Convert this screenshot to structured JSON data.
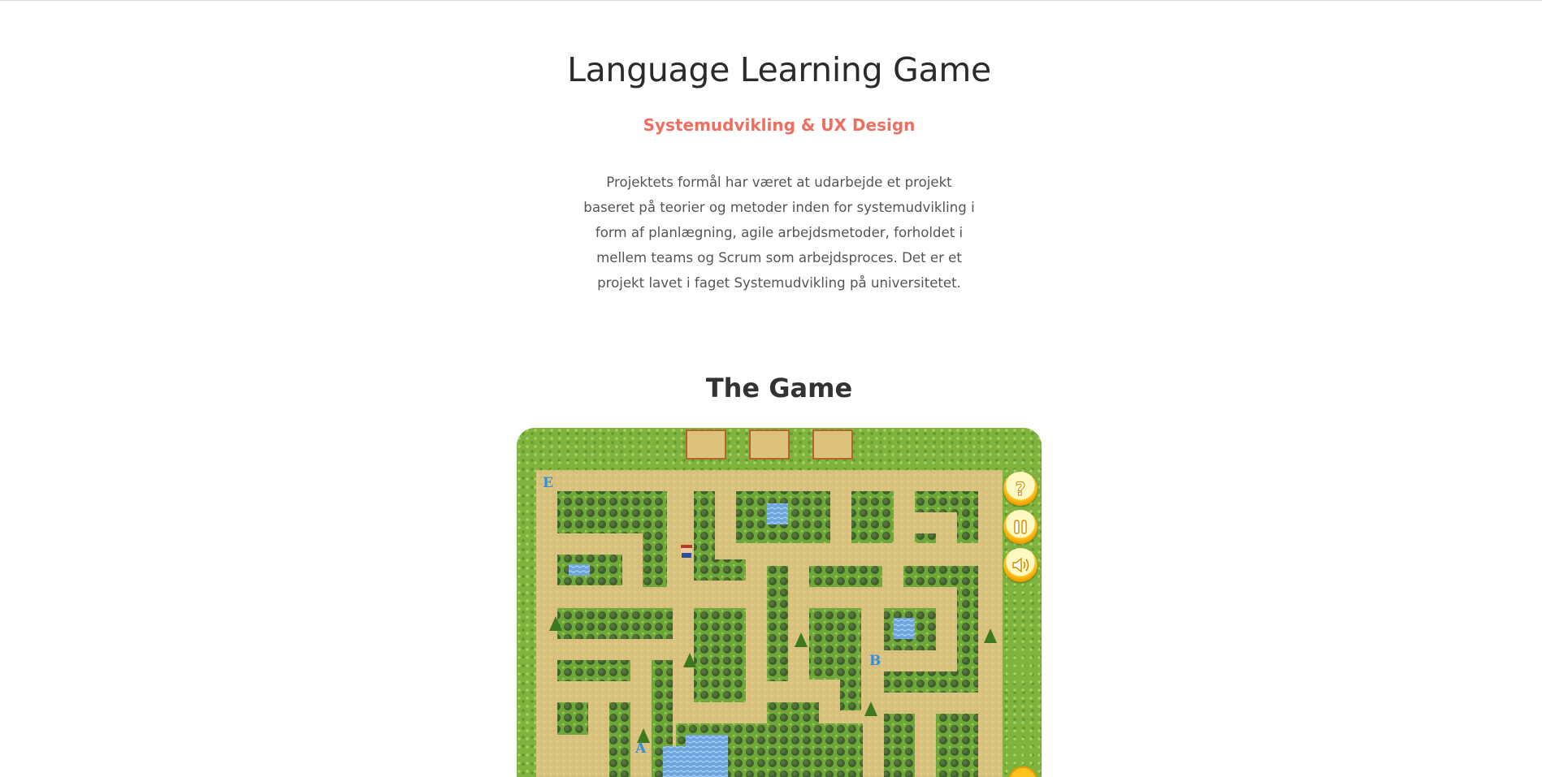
{
  "header": {
    "title": "Language Learning Game",
    "subtitle": "Systemudvikling & UX Design",
    "description": "Projektets formål har været at udarbejde et projekt baseret på teorier og metoder inden for systemudvikling i form af planlægning, agile arbejdsmetoder, forholdet i mellem teams og Scrum som arbejdsproces. Det er et projekt lavet i faget Systemudvikling på universitetet."
  },
  "game_section": {
    "title": "The Game",
    "letters": [
      "E",
      "B",
      "A"
    ],
    "controls": [
      {
        "name": "help-button",
        "icon": "question-mark-icon"
      },
      {
        "name": "pause-button",
        "icon": "pause-icon"
      },
      {
        "name": "sound-button",
        "icon": "speaker-icon"
      }
    ],
    "colors": {
      "grass": "#7fb23f",
      "path": "#d8c27e",
      "hedge": "#4f8a2a",
      "water": "#6fa6e0",
      "letter": "#2f8fe0",
      "button": "#ffc21f",
      "slot_border": "#b4622e"
    }
  }
}
